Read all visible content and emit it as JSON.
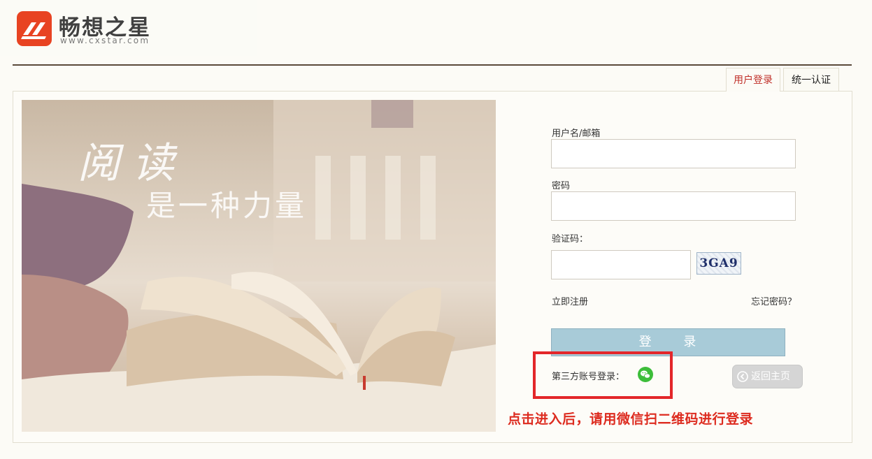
{
  "brand": {
    "name": "畅想之星",
    "url": "www.cxstar.com",
    "color": "#e84322"
  },
  "tabs": [
    {
      "label": "用户登录",
      "active": true
    },
    {
      "label": "统一认证",
      "active": false
    }
  ],
  "hero": {
    "line1": "阅读",
    "line2": "是一种力量"
  },
  "form": {
    "username_label": "用户名/邮箱",
    "username_value": "",
    "password_label": "密码",
    "password_value": "",
    "captcha_label": "验证码：",
    "captcha_value": "",
    "captcha_text": "3GA9",
    "register_link": "立即注册",
    "forgot_link": "忘记密码？",
    "login_button": "登 录",
    "thirdparty_label": "第三方账号登录：",
    "home_button": "返回主页"
  },
  "annotation": "点击进入后，请用微信扫二维码进行登录",
  "colors": {
    "login_button": "#a8cbd8",
    "annotation": "#dd2b1f",
    "wechat": "#3dbd3a",
    "active_tab": "#c0302a"
  }
}
